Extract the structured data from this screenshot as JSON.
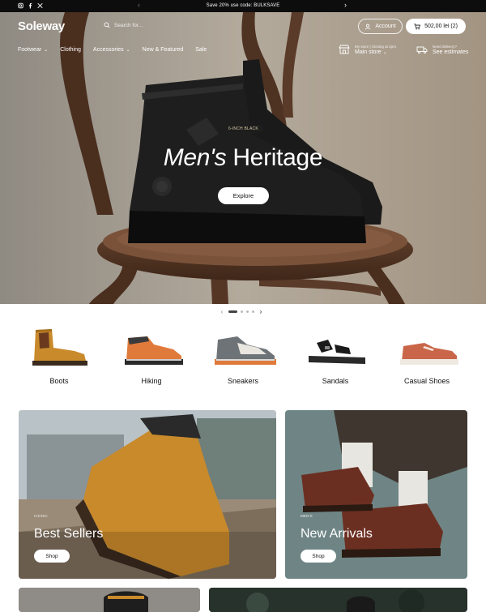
{
  "announcement": {
    "message": "Save 20% use code: BULKSAVE",
    "prev_icon": "chevron-left-icon",
    "next_icon": "chevron-right-icon",
    "social_icons": [
      "instagram-icon",
      "facebook-icon",
      "x-icon"
    ]
  },
  "header": {
    "logo": "Soleway",
    "search_placeholder": "Search for...",
    "account_label": "Account",
    "cart_label": "502,00 lei (2)"
  },
  "nav": {
    "items": [
      {
        "label": "Footwear",
        "dropdown": true
      },
      {
        "label": "Clothing",
        "dropdown": false
      },
      {
        "label": "Accessories",
        "dropdown": true
      },
      {
        "label": "New & Featured",
        "dropdown": false
      },
      {
        "label": "Sale",
        "dropdown": false
      }
    ]
  },
  "store": {
    "line1": "My store  |  Closing at 2pm",
    "line2": "Main store"
  },
  "delivery": {
    "line1": "Need delivery?",
    "line2": "See estimates"
  },
  "hero": {
    "tag": "6-INCH BLACK",
    "title_italic": "Men's",
    "title_rest": " Heritage",
    "button_label": "Explore"
  },
  "slider": {
    "total": 4,
    "active": 1
  },
  "categories": [
    {
      "label": "Boots"
    },
    {
      "label": "Hiking"
    },
    {
      "label": "Sneakers"
    },
    {
      "label": "Sandals"
    },
    {
      "label": "Casual Shoes"
    }
  ],
  "promos": [
    {
      "tag": "ICONIC",
      "title": "Best Sellers",
      "button": "Shop"
    },
    {
      "tag": "MEN'S",
      "title": "New Arrivals",
      "button": "Shop"
    }
  ],
  "colors": {
    "announce_bg": "#0d0d0d",
    "boot_tan": "#c98a2c",
    "accent_orange": "#e07a3b"
  }
}
